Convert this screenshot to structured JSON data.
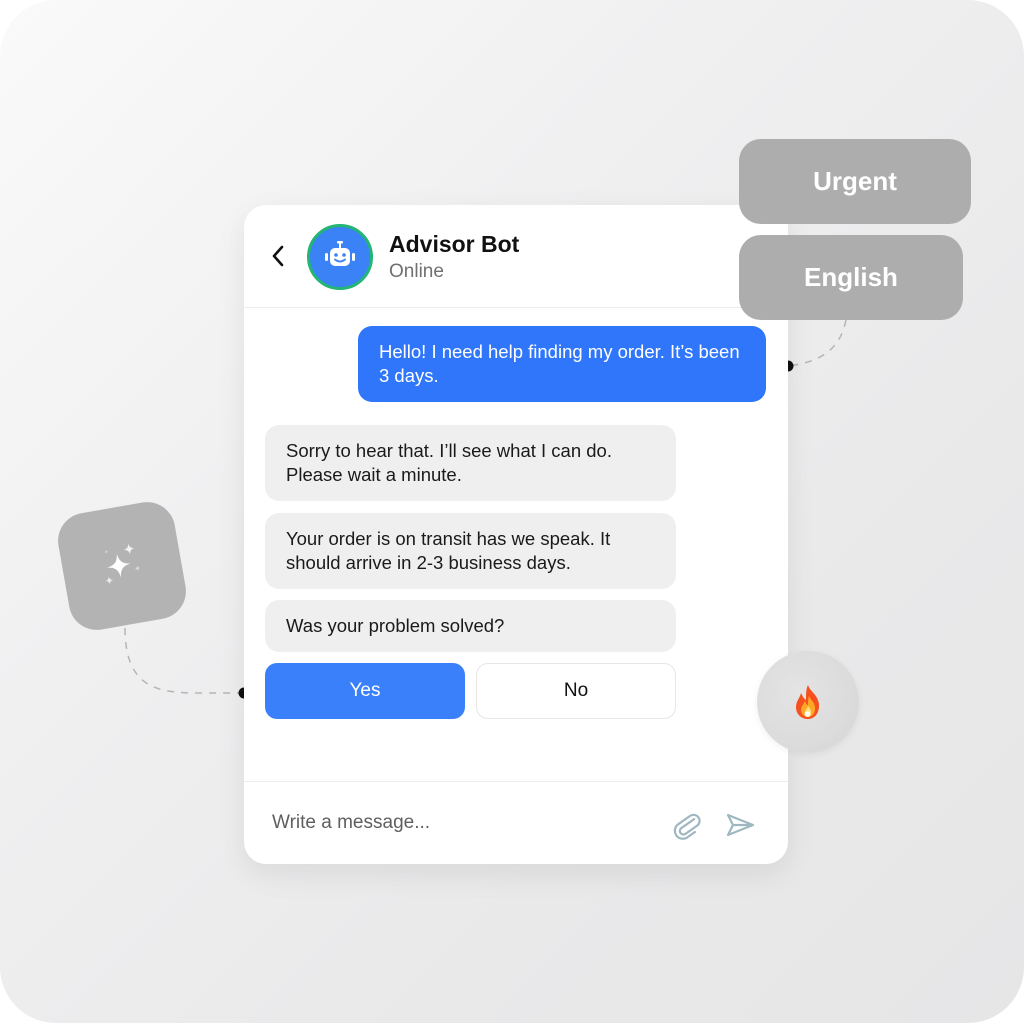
{
  "chat": {
    "bot_name": "Advisor Bot",
    "status": "Online",
    "messages": [
      {
        "sender": "user",
        "text": "Hello! I need help finding my order. It’s been 3 days."
      },
      {
        "sender": "bot",
        "text": "Sorry to hear that. I’ll see what I can do. Please wait a minute."
      },
      {
        "sender": "bot",
        "text": "Your order is on transit has we speak. It should arrive in 2-3 business days."
      },
      {
        "sender": "bot",
        "text": "Was your problem solved?"
      }
    ],
    "quick_replies": {
      "yes": "Yes",
      "no": "No"
    },
    "input": {
      "placeholder": "Write a message...",
      "value": ""
    }
  },
  "tags": {
    "urgent": "Urgent",
    "english": "English"
  },
  "icons": {
    "back": "chevron-left-icon",
    "avatar": "robot-icon",
    "attach": "paperclip-icon",
    "send": "send-icon",
    "sparkle": "sparkles-icon",
    "fire": "fire-icon"
  },
  "colors": {
    "accent": "#2f76fb",
    "button_primary": "#3b80fb",
    "online_ring": "#22b573",
    "bot_bubble": "#efefef",
    "tag_bg": "#adadae",
    "input_icons": "#9fb7c1"
  },
  "decor": {
    "fire_emoji": "🔥"
  }
}
